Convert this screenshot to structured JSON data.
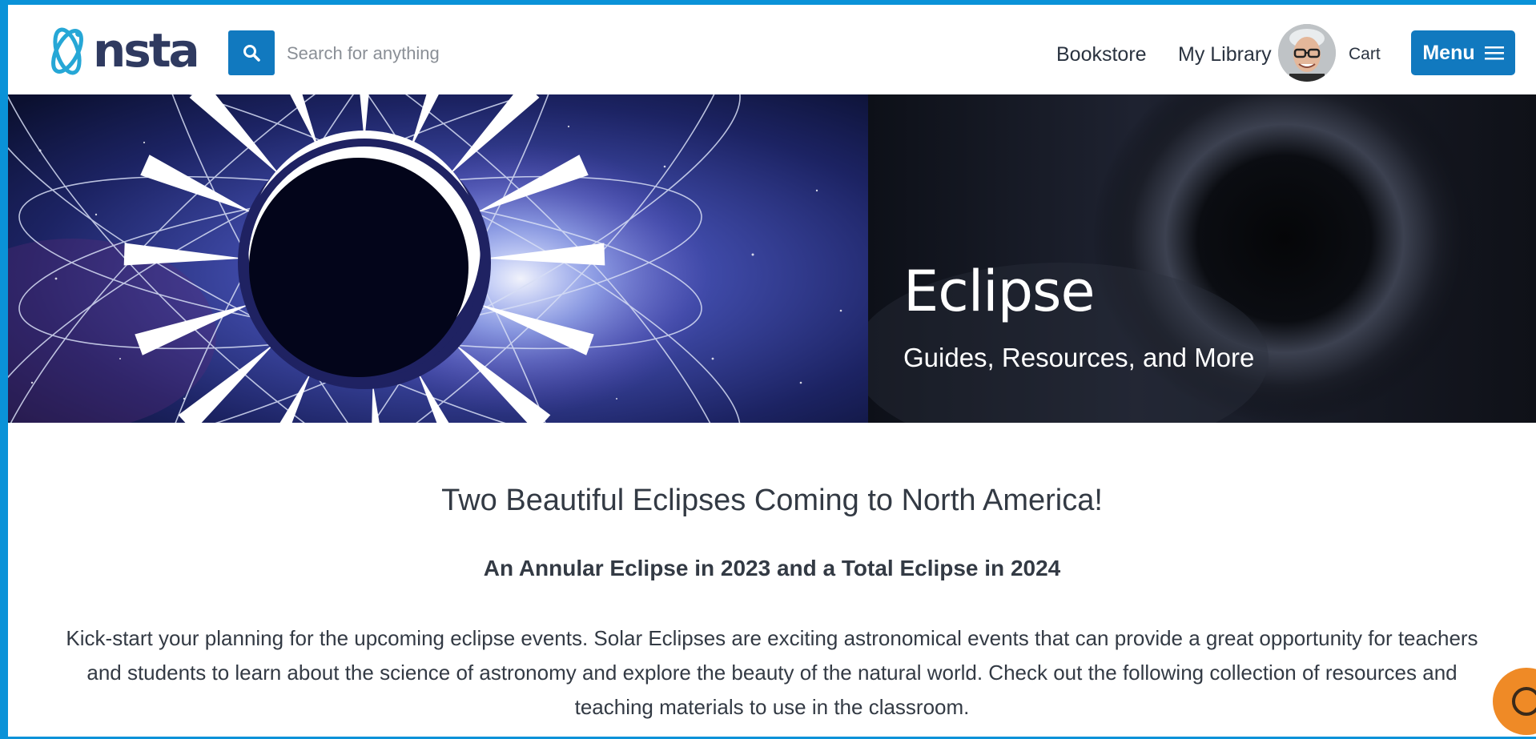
{
  "header": {
    "logo_text": "nsta",
    "search": {
      "placeholder": "Search for anything",
      "value": ""
    },
    "nav": {
      "bookstore": "Bookstore",
      "my_library": "My Library",
      "cart": "Cart",
      "menu": "Menu"
    }
  },
  "hero": {
    "title": "Eclipse",
    "subtitle": "Guides, Resources, and More"
  },
  "main": {
    "headline": "Two Beautiful Eclipses Coming to North America!",
    "subheadline": "An Annular Eclipse in 2023 and a Total Eclipse in 2024",
    "body": "Kick-start your planning for the upcoming eclipse events. Solar Eclipses are exciting astronomical events that can provide a great opportunity for teachers and students to learn about the science of astronomy and explore the beauty of the natural world. Check out the following collection of resources and teaching materials to use in the classroom."
  },
  "colors": {
    "page_border": "#0a92d8",
    "accent_blue": "#1179bf",
    "logo_navy": "#2f3a60",
    "logo_teal": "#26a7d6",
    "help_orange": "#ef8a26"
  },
  "icons": {
    "logo": "nsta-atom-logo-icon",
    "search": "search-icon",
    "menu": "hamburger-menu-icon",
    "help": "help-chat-icon"
  }
}
